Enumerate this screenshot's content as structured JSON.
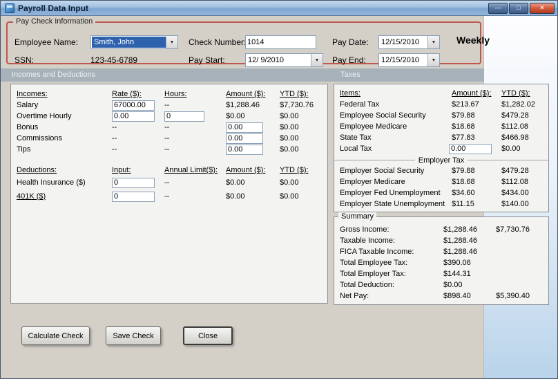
{
  "window": {
    "title": "Payroll Data Input"
  },
  "icons": {
    "minimize": "—",
    "maximize": "□",
    "close": "✕",
    "dropdown": "▼"
  },
  "paycheck": {
    "group_label": "Pay Check Information",
    "employee_label": "Employee Name:",
    "employee_value": "Smith, John",
    "ssn_label": "SSN:",
    "ssn_value": "123-45-6789",
    "check_number_label": "Check Number:",
    "check_number_value": "1014",
    "pay_start_label": "Pay Start:",
    "pay_start_value": "12/ 9/2010",
    "pay_date_label": "Pay Date:",
    "pay_date_value": "12/15/2010",
    "pay_end_label": "Pay End:",
    "pay_end_value": "12/15/2010",
    "frequency": "Weekly"
  },
  "bands": {
    "incomes_deductions": "Incomes and Deductions",
    "taxes": "Taxes"
  },
  "incomes": {
    "headers": {
      "name": "Incomes:",
      "rate": "Rate ($):",
      "hours": "Hours:",
      "amount": "Amount ($):",
      "ytd": "YTD ($):"
    },
    "rows": [
      {
        "label": "Salary",
        "rate": "67000.00",
        "hours": "--",
        "amount": "$1,288.46",
        "ytd": "$7,730.76"
      },
      {
        "label": "Overtime Hourly",
        "rate": "0.00",
        "hours": "0",
        "amount": "$0.00",
        "ytd": "$0.00"
      },
      {
        "label": "Bonus",
        "rate": "--",
        "hours": "--",
        "amount": "0.00",
        "ytd": "$0.00"
      },
      {
        "label": "Commissions",
        "rate": "--",
        "hours": "--",
        "amount": "0.00",
        "ytd": "$0.00"
      },
      {
        "label": "Tips",
        "rate": "--",
        "hours": "--",
        "amount": "0.00",
        "ytd": "$0.00"
      }
    ]
  },
  "deductions": {
    "headers": {
      "name": "Deductions:",
      "input": "Input:",
      "limit": "Annual Limit($):",
      "amount": "Amount ($):",
      "ytd": "YTD ($):"
    },
    "rows": [
      {
        "label": "Health Insurance ($)",
        "input": "0",
        "limit": "--",
        "amount": "$0.00",
        "ytd": "$0.00"
      },
      {
        "label": "401K ($)",
        "input": "0",
        "limit": "--",
        "amount": "$0.00",
        "ytd": "$0.00"
      }
    ]
  },
  "taxes": {
    "headers": {
      "items": "Items:",
      "amount": "Amount ($):",
      "ytd": "YTD ($):"
    },
    "rows": [
      {
        "label": "Federal Tax",
        "amount": "$213.67",
        "ytd": "$1,282.02"
      },
      {
        "label": "Employee Social Security",
        "amount": "$79.88",
        "ytd": "$479.28"
      },
      {
        "label": "Employee Medicare",
        "amount": "$18.68",
        "ytd": "$112.08"
      },
      {
        "label": "State Tax",
        "amount": "$77.83",
        "ytd": "$466.98"
      },
      {
        "label": "Local Tax",
        "amount": "0.00",
        "ytd": "$0.00"
      }
    ],
    "employer_header": "Employer Tax",
    "employer_rows": [
      {
        "label": "Employer Social Security",
        "amount": "$79.88",
        "ytd": "$479.28"
      },
      {
        "label": "Employer Medicare",
        "amount": "$18.68",
        "ytd": "$112.08"
      },
      {
        "label": "Employer Fed Unemployment",
        "amount": "$34.60",
        "ytd": "$434.00"
      },
      {
        "label": "Employer State Unemployment",
        "amount": "$11.15",
        "ytd": "$140.00"
      }
    ]
  },
  "summary": {
    "group_label": "Summary",
    "rows": [
      {
        "label": "Gross Income:",
        "value": "$1,288.46",
        "ytd": "$7,730.76"
      },
      {
        "label": "Taxable Income:",
        "value": "$1,288.46",
        "ytd": ""
      },
      {
        "label": "FICA Taxable Income:",
        "value": "$1,288.46",
        "ytd": ""
      },
      {
        "label": "Total Employee Tax:",
        "value": "$390.06",
        "ytd": ""
      },
      {
        "label": "Total Employer Tax:",
        "value": "$144.31",
        "ytd": ""
      },
      {
        "label": "Total Deduction:",
        "value": "$0.00",
        "ytd": ""
      },
      {
        "label": "Net Pay:",
        "value": "$898.40",
        "ytd": "$5,390.40"
      }
    ]
  },
  "buttons": {
    "calculate": "Calculate Check",
    "save": "Save Check",
    "close": "Close"
  }
}
